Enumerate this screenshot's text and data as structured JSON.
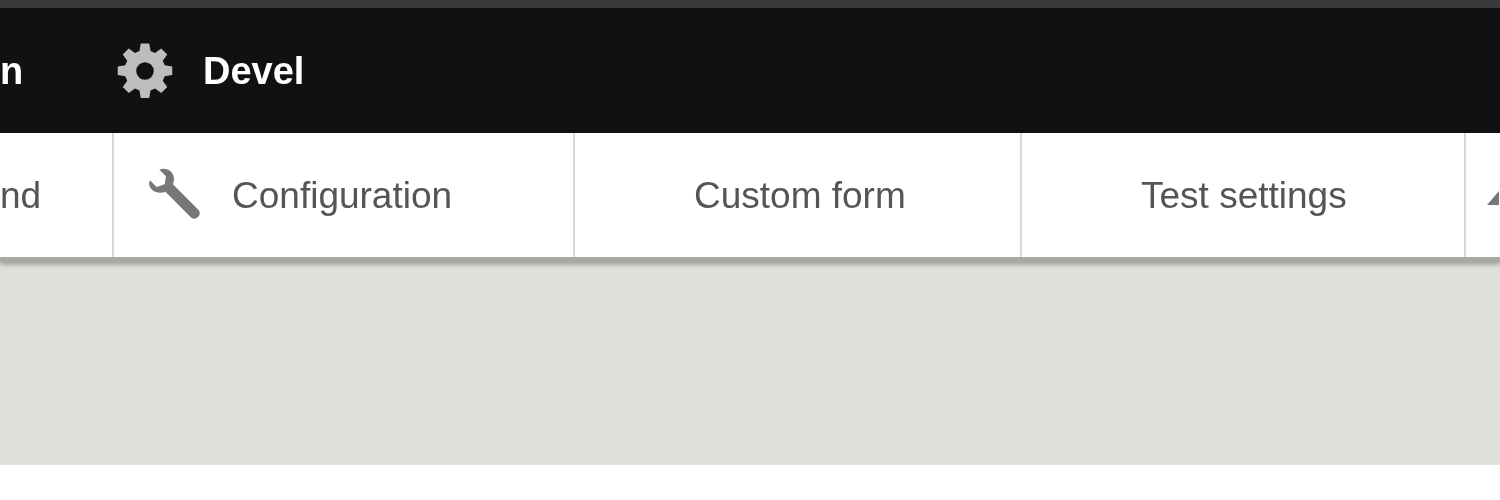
{
  "toolbar": {
    "items": [
      {
        "label": "n",
        "kind": "plain"
      },
      {
        "label": "Devel",
        "kind": "icon"
      }
    ]
  },
  "tray": {
    "items": [
      {
        "label": "nd",
        "kind": "plain"
      },
      {
        "label": "Configuration",
        "kind": "icon"
      },
      {
        "label": "Custom form",
        "kind": "plain"
      },
      {
        "label": "Test settings",
        "kind": "plain"
      },
      {
        "kind": "icon-only"
      }
    ]
  }
}
